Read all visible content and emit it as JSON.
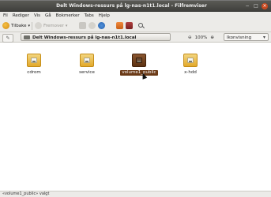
{
  "window": {
    "title": "Delt Windows-ressurs på lg-nas-n1t1.local - Filfremviser",
    "controls": [
      "−",
      "□",
      "×"
    ]
  },
  "menu": [
    "Fil",
    "Rediger",
    "Vis",
    "Gå",
    "Bokmerker",
    "Tabs",
    "Hjelp"
  ],
  "toolbar": {
    "back_label": "Tilbake",
    "forward_label": "Fremover",
    "icons": [
      "back-icon",
      "forward-icon",
      "up-icon",
      "stop-icon",
      "reload-icon",
      "home-icon",
      "computer-icon",
      "search-icon"
    ]
  },
  "location": {
    "edit_icon": "✎",
    "path": "Delt Windows-ressurs på lg-nas-n1t1.local",
    "zoom": "100%",
    "view_mode": "Ikonvisning"
  },
  "files": [
    {
      "name": "cdrom",
      "selected": false
    },
    {
      "name": "service",
      "selected": false
    },
    {
      "name": "volume1_public",
      "selected": true
    },
    {
      "name": "x-hdd",
      "selected": false
    }
  ],
  "status": "«volume1_public» valgt"
}
